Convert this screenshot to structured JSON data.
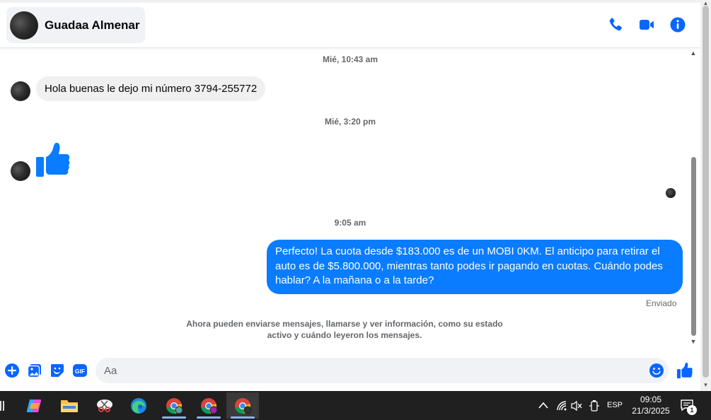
{
  "header": {
    "contact_name": "Guadaa Almenar",
    "icons": [
      "phone-icon",
      "video-icon",
      "info-icon"
    ]
  },
  "messages": {
    "time_1": "Mié, 10:43 am",
    "incoming_1": "Hola buenas le dejo mi número 3794-255772",
    "time_2": "Mié, 3:20 pm",
    "incoming_2_sticker": "thumbs-up-icon",
    "time_3": "9:05 am",
    "outgoing_1": "Perfecto! La cuota desde $183.000 es de un MOBI 0KM. El anticipo para retirar el auto es de $5.800.000, mientras tanto podes ir pagando en cuotas. Cuándo podes hablar? A la mañana o a la tarde?",
    "status": "Enviado",
    "notice": "Ahora pueden enviarse mensajes, llamarse y ver información, como su estado activo y cuándo leyeron los mensajes."
  },
  "composer": {
    "placeholder": "Aa",
    "icons": [
      "plus-icon",
      "image-icon",
      "sticker-icon",
      "gif-icon",
      "emoji-icon",
      "like-icon"
    ],
    "gif_label": "GIF"
  },
  "taskbar": {
    "language": "ESP",
    "time": "09:05",
    "date": "21/3/2025",
    "notifications": "1"
  },
  "colors": {
    "accent": "#0a7cff",
    "icon_blue": "#0866ff",
    "incoming_bg": "#f0f0f0",
    "muted_text": "#65676b",
    "taskbar_bg": "#202020"
  }
}
